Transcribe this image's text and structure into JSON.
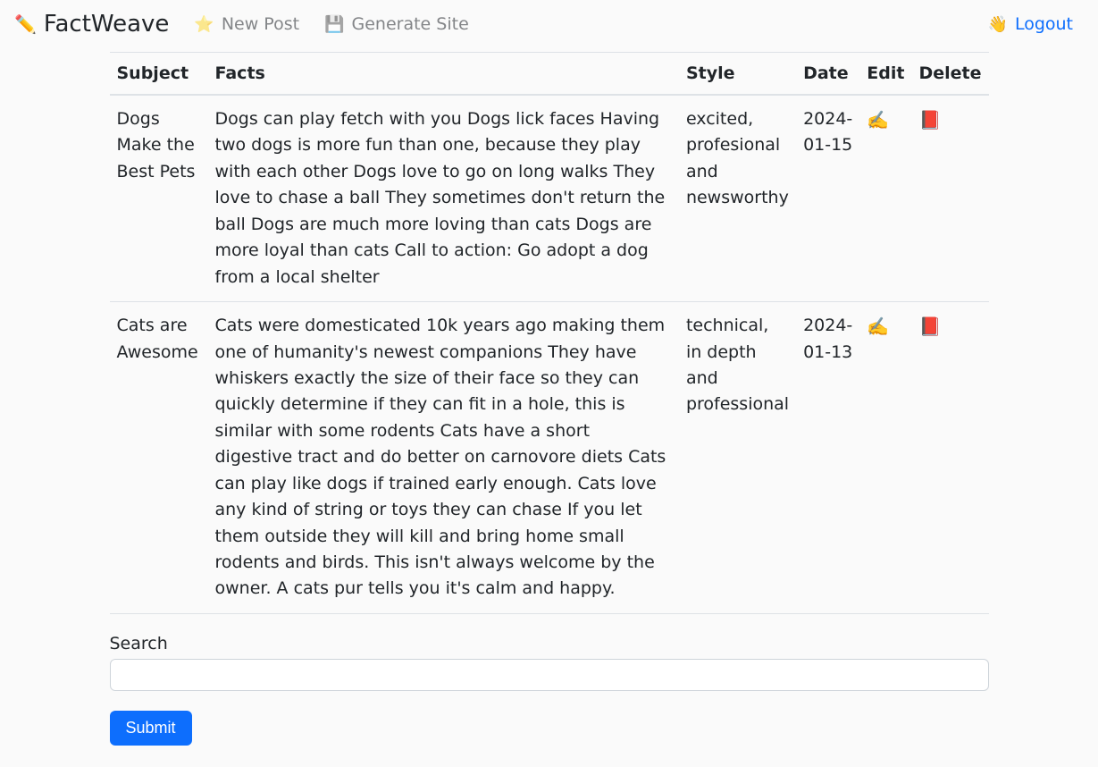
{
  "brand": {
    "name": "FactWeave",
    "icon": "✏️"
  },
  "nav": {
    "newPost": {
      "label": "New Post",
      "icon": "⭐"
    },
    "generateSite": {
      "label": "Generate Site",
      "icon": "💾"
    },
    "logout": {
      "label": "Logout",
      "icon": "👋"
    }
  },
  "table": {
    "headers": {
      "subject": "Subject",
      "facts": "Facts",
      "style": "Style",
      "date": "Date",
      "edit": "Edit",
      "delete": "Delete"
    },
    "rows": [
      {
        "subject": "Dogs Make the Best Pets",
        "facts": "Dogs can play fetch with you Dogs lick faces Having two dogs is more fun than one, because they play with each other Dogs love to go on long walks They love to chase a ball They sometimes don't return the ball Dogs are much more loving than cats Dogs are more loyal than cats Call to action: Go adopt a dog from a local shelter",
        "style": "excited, profesional and newsworthy",
        "date": "2024-01-15",
        "editIcon": "✍️",
        "deleteIcon": "📕"
      },
      {
        "subject": "Cats are Awesome",
        "facts": "Cats were domesticated 10k years ago making them one of humanity's newest companions They have whiskers exactly the size of their face so they can quickly determine if they can fit in a hole, this is similar with some rodents Cats have a short digestive tract and do better on carnovore diets Cats can play like dogs if trained early enough. Cats love any kind of string or toys they can chase If you let them outside they will kill and bring home small rodents and birds. This isn't always welcome by the owner. A cats pur tells you it's calm and happy.",
        "style": "technical, in depth and professional",
        "date": "2024-01-13",
        "editIcon": "✍️",
        "deleteIcon": "📕"
      }
    ]
  },
  "search": {
    "label": "Search",
    "submitLabel": "Submit",
    "value": ""
  }
}
